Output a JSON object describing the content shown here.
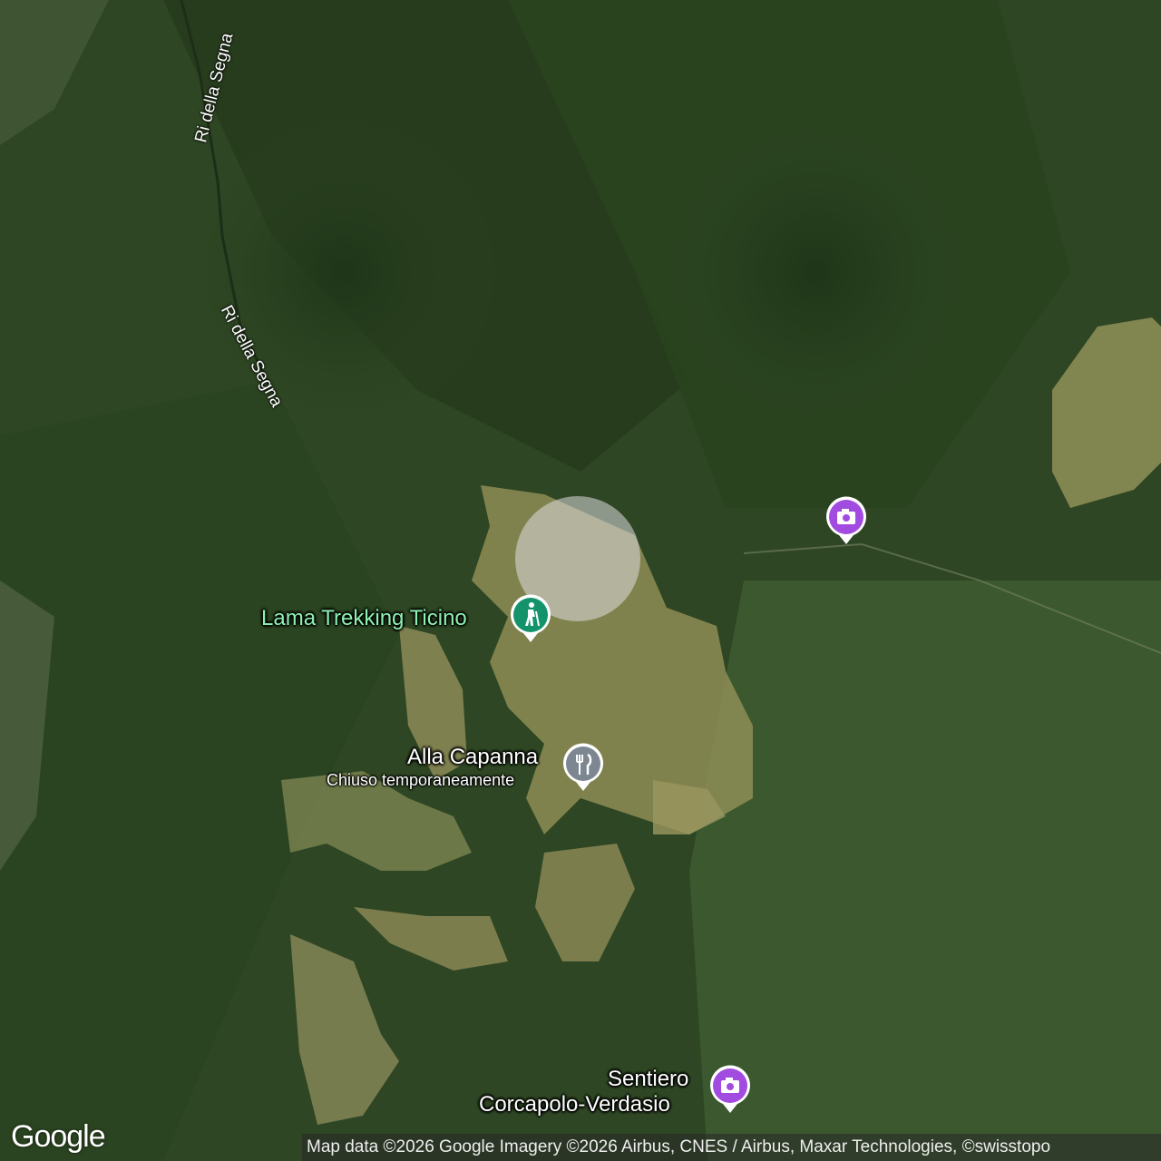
{
  "map": {
    "type": "satellite",
    "colors": {
      "forest": "#2f4a25",
      "meadow": "#9a9a5a",
      "hiking": "#14936b",
      "restaurant": "#7d8791",
      "photo": "#a24be0"
    }
  },
  "water_labels": [
    "Ri della Segna",
    "Ri della Segna"
  ],
  "places": [
    {
      "name": "Lama Trekking Ticino",
      "icon": "hiking-icon"
    },
    {
      "name": "Alla Capanna",
      "status": "Chiuso temporaneamente",
      "icon": "restaurant-icon"
    },
    {
      "name": "",
      "icon": "photo-camera-icon"
    },
    {
      "name_line1": "Sentiero",
      "name_line2": "Corcapolo-Verdasio",
      "icon": "photo-camera-icon"
    }
  ],
  "logo": "Google",
  "attribution": "Map data ©2026 Google Imagery ©2026 Airbus, CNES / Airbus, Maxar Technologies, ©swisstopo"
}
